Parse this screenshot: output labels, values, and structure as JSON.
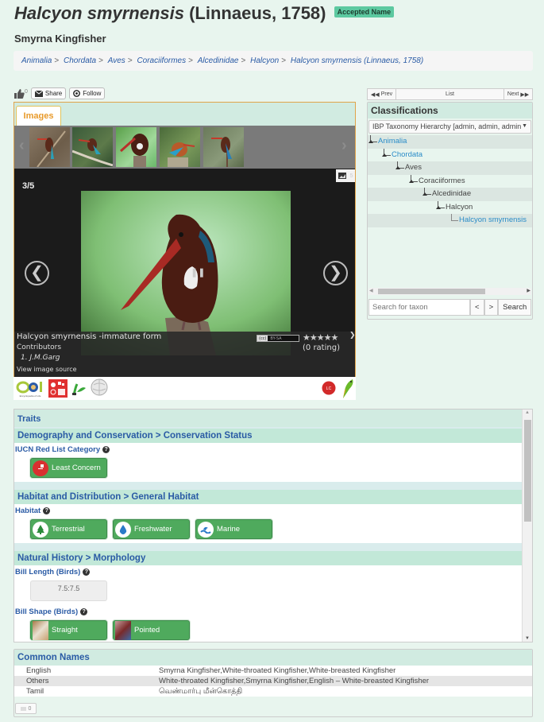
{
  "header": {
    "title_italic": "Halcyon smyrnensis",
    "title_author": " (Linnaeus, 1758)",
    "badge": "Accepted Name",
    "common_name": "Smyrna Kingfisher"
  },
  "breadcrumb": [
    "Animalia",
    "Chordata",
    "Aves",
    "Coraciiformes",
    "Alcedinidae",
    "Halcyon",
    "Halcyon smyrnensis (Linnaeus, 1758)"
  ],
  "breadcrumb_separator": ">",
  "actions": {
    "like_count": "0",
    "share_label": "Share",
    "follow_label": "Follow"
  },
  "gallery": {
    "tab_label": "Images",
    "counter": "3/5",
    "image_count": "5",
    "thumbnails": 5,
    "selected_index": 3,
    "caption": "Halcyon smyrnensis -immature form",
    "contributors_label": "Contributors",
    "contributor": "1. J.M.Garg",
    "view_source": "View image source",
    "license": "BY-SA",
    "rating_stars": 0,
    "rating_text": "(0 rating)",
    "prev_icon": "chevron-left",
    "next_icon": "chevron-right"
  },
  "logos": [
    "Encyclopedia of Life",
    "IUCN Red List",
    "GBIF",
    "Wikipedia",
    "LC",
    "Bird"
  ],
  "logo_eol_text": "Encyclopedia of Life",
  "logo_lc_text": "LC",
  "species_nav": {
    "prev_label": "Prev",
    "list_label": "List",
    "next_label": "Next"
  },
  "classifications": {
    "title": "Classifications",
    "selected_hierarchy": "IBP Taxonomy Hierarchy [admin, admin, admin",
    "tree": [
      {
        "label": "Animalia",
        "link": true
      },
      {
        "label": "Chordata",
        "link": true
      },
      {
        "label": "Aves",
        "link": false
      },
      {
        "label": "Coraciiformes",
        "link": false
      },
      {
        "label": "Alcedinidae",
        "link": false
      },
      {
        "label": "Halcyon",
        "link": false
      },
      {
        "label": "Halcyon smyrnensis",
        "link": true
      }
    ],
    "search_placeholder": "Search for taxon",
    "prev_btn": "<",
    "next_btn": ">",
    "search_btn": "Search"
  },
  "traits": {
    "title": "Traits",
    "sections": [
      {
        "heading": "Demography and Conservation > Conservation Status",
        "trait": "IUCN Red List Category",
        "values": [
          "Least Concern"
        ]
      },
      {
        "heading": "Habitat and Distribution > General Habitat",
        "trait": "Habitat",
        "values": [
          "Terrestrial",
          "Freshwater",
          "Marine"
        ]
      },
      {
        "heading": "Natural History > Morphology",
        "trait": "Bill Length (Birds)",
        "numeric_value": "7.5:7.5",
        "trait2": "Bill Shape (Birds)",
        "values2": [
          "Straight",
          "Pointed"
        ]
      }
    ]
  },
  "common_names": {
    "title": "Common Names",
    "rows": [
      {
        "language": "English",
        "names": "Smyrna Kingfisher,White-throated Kingfisher,White-breasted Kingfisher"
      },
      {
        "language": "Others",
        "names": "White-throated Kingfisher,Smyrna Kingfisher,English – White-breasted Kingfisher"
      },
      {
        "language": "Tamil",
        "names": "வெண்மார்பு மீன்கொத்தி"
      }
    ],
    "comment_count": "0"
  },
  "colors": {
    "page_bg": "#e8f5ee",
    "panel_header": "#d1ebe1",
    "section_header": "#c2e8d8",
    "link_blue": "#2a5ba5",
    "tree_link": "#2a8cc8",
    "trait_green": "#4faa5d",
    "tab_orange": "#e89a2a",
    "badge_green": "#5cc9a0"
  }
}
